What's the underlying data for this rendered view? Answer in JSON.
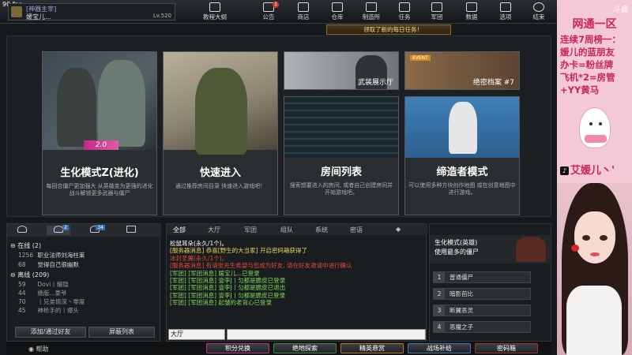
{
  "topbar": {
    "fps": "90 fps",
    "player_title": "[神器主宰]",
    "player_name": "媛宝儿...",
    "level": "Lv.520",
    "nav": [
      {
        "label": "教程大纲",
        "icon": "book-icon"
      },
      {
        "label": "公告",
        "icon": "megaphone-icon",
        "badge": "1"
      },
      {
        "label": "商店",
        "icon": "shop-icon"
      },
      {
        "label": "仓库",
        "icon": "warehouse-icon"
      },
      {
        "label": "制造所",
        "icon": "factory-icon"
      },
      {
        "label": "任务",
        "icon": "mission-icon"
      },
      {
        "label": "军团",
        "icon": "clan-icon"
      },
      {
        "label": "数据",
        "icon": "chart-icon"
      },
      {
        "label": "选项",
        "icon": "gear-icon"
      },
      {
        "label": "结束",
        "icon": "power-icon"
      }
    ],
    "notice": "领取了新的每日任务！"
  },
  "modes": [
    {
      "title": "生化模式Z(进化)",
      "badge": "2.0",
      "desc": "每回合僵尸更加强大 从英雄变为更强的进化 战斗解锁更多武器与僵尸"
    },
    {
      "title": "快速进入",
      "desc": "通过推荐房间目录 快速进入游戏吧！"
    },
    {
      "title": "房间列表",
      "desc": "搜索想要进入的房间, 或者自己创建房间并开始游戏吧。"
    },
    {
      "title": "缔造者模式",
      "desc": "可以使用多种方块创作地图 或在创意地图中进行游戏。"
    }
  ],
  "small_tiles": [
    {
      "caption": "武装展示厅"
    },
    {
      "caption": "绝密档案 #7",
      "event": "EVENT"
    }
  ],
  "friends": {
    "tab_badge_1": "2",
    "tab_badge_2": "34",
    "online_label": "在线 (2)",
    "online": [
      {
        "num": "1256",
        "name": "职业法师刘海柱莱"
      },
      {
        "num": "68",
        "name": "觉得自己很幽默"
      }
    ],
    "offline_label": "离线 (209)",
    "offline": [
      {
        "num": "59",
        "name": "Dovi丨耀隐"
      },
      {
        "num": "44",
        "name": "绝版...豪爷"
      },
      {
        "num": "70",
        "name": "丨兄弟情深丶零度"
      },
      {
        "num": "45",
        "name": "神枪手的丨爆头"
      }
    ],
    "add_button": "添加/通过好友",
    "block_button": "屏蔽列表"
  },
  "chat": {
    "tabs": [
      "全部",
      "大厅",
      "军团",
      "组队",
      "系统",
      "密语"
    ],
    "lines": [
      {
        "text": "松鼠耳朵(永久/1个)。",
        "color": "#ffffff"
      },
      {
        "text": "[服务器消息] 恭喜[野生的大当家] 开启密码箱获得了",
        "color": "#e8d35a"
      },
      {
        "text": "冰封圣翼(永久/1个)。",
        "color": "#e2483a"
      },
      {
        "text": "[服务器消息] 有请张先生希望与您成为好友, 请在好友邀请中进行确认",
        "color": "#e2483a"
      },
      {
        "text": "[军团] [军团消息] 媛宝儿...已登录",
        "color": "#7ed957"
      },
      {
        "text": "[军团] [军团消息] 壹李J丨匀都是脆皮已登录",
        "color": "#7ed957"
      },
      {
        "text": "[军团] [军团消息] 壹李J丨匀都是脆皮已退出",
        "color": "#7ed957"
      },
      {
        "text": "[军团] [军团消息] 壹李J丨匀都是脆皮已登录",
        "color": "#7ed957"
      },
      {
        "text": "[军团] [军团消息] 起皱的老背心已登录",
        "color": "#7ed957"
      }
    ],
    "channel": "大厅"
  },
  "zombie_panel": {
    "title1": "生化模式(英雄)",
    "title2": "使用最多的僵尸",
    "items": [
      {
        "num": "1",
        "label": "普通僵尸"
      },
      {
        "num": "2",
        "label": "暗影芭比"
      },
      {
        "num": "3",
        "label": "断翼恶灵"
      },
      {
        "num": "4",
        "label": "恶魔之子"
      }
    ]
  },
  "bottom_bar": {
    "help": "帮助",
    "buttons": [
      {
        "label": "积分兑换",
        "accent": "#c0308a"
      },
      {
        "label": "绝地探索",
        "accent": "#3a8a3a"
      },
      {
        "label": "精英悬赏",
        "accent": "#c0701c"
      },
      {
        "label": "战场补给",
        "accent": "#3a78b0"
      },
      {
        "label": "密码箱",
        "accent": "#a03030"
      }
    ]
  },
  "sidebar": {
    "logo": "斗鱼",
    "room": "网通一区",
    "lines": [
      "连续7周榜一：",
      "媛儿的蓝朋友",
      "办卡=粉丝牌",
      "飞机*2=房管",
      "+YY黄马"
    ],
    "tiktok": "艾媛儿丶'",
    "tiktok_icon": "♪"
  }
}
